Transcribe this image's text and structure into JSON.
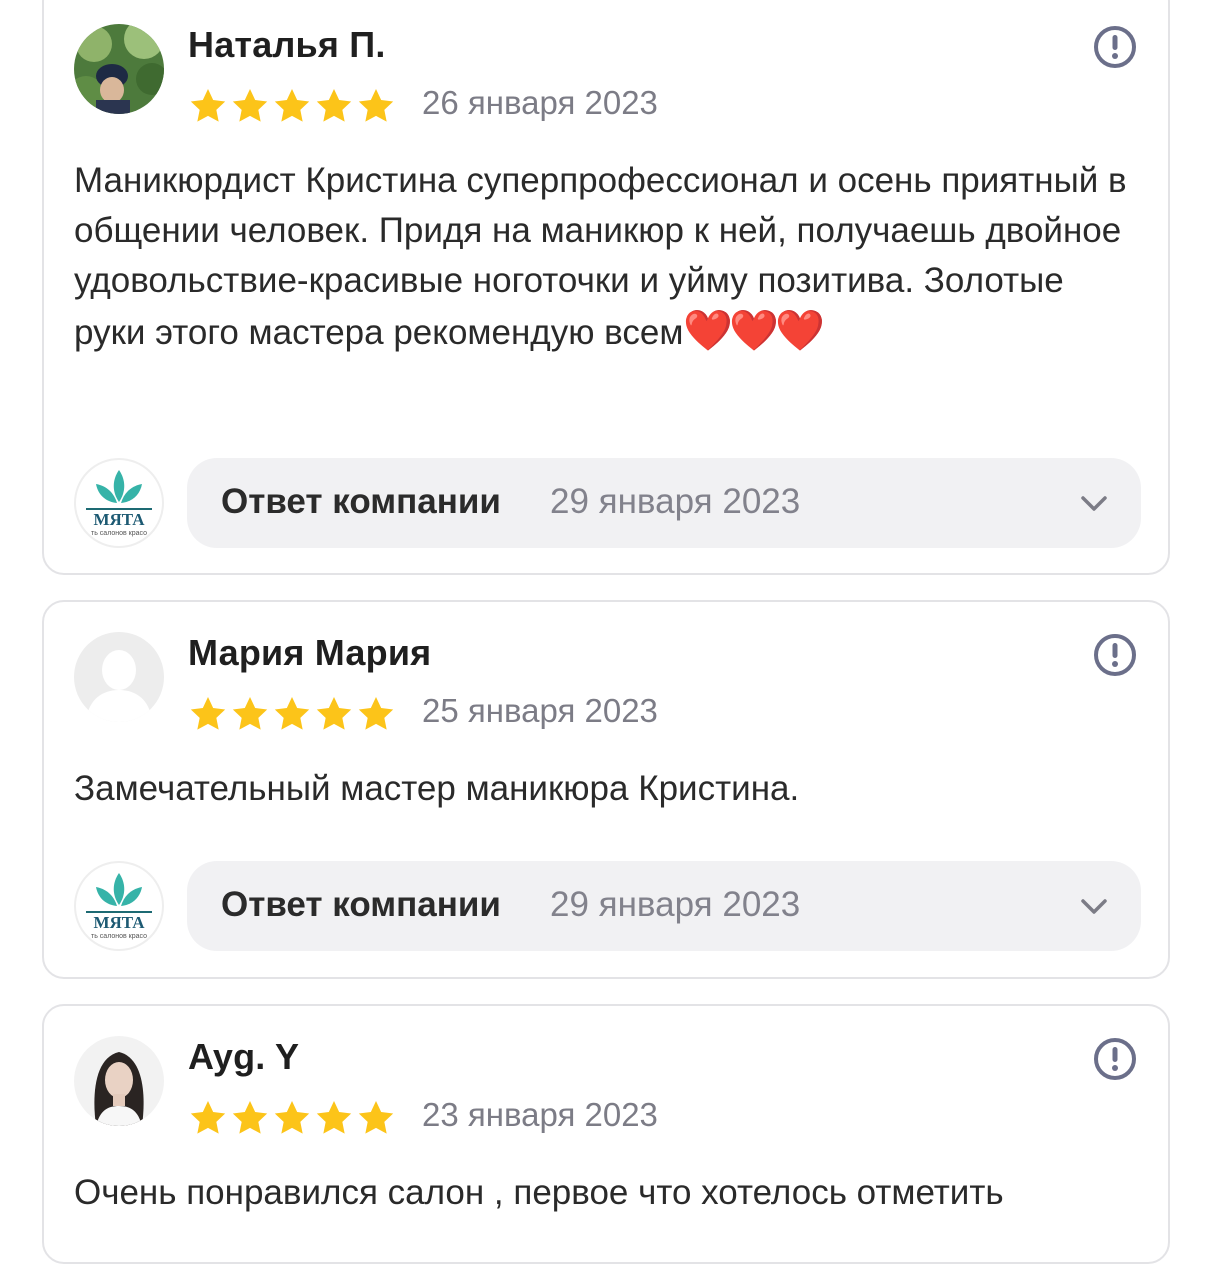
{
  "colors": {
    "star": "#fcc419",
    "report_icon": "#6b6f8a",
    "heart": "#e1222b",
    "logo_leaf": "#36b3a8"
  },
  "company": {
    "logo_text": "МЯТА",
    "logo_subtext": "ть салонов красо"
  },
  "reviews": [
    {
      "author": "Наталья П.",
      "rating": 5,
      "date": "26 января 2023",
      "text": "Маникюрдист Кристина суперпрофессионал и осень приятный в общении человек. Придя на маникюр к ней, получаешь двойное удовольствие-красивые ноготочки и уйму позитива. Золотые руки этого мастера рекомендую всем",
      "emoji": "❤️❤️❤️",
      "reply_label": "Ответ компании",
      "reply_date": "29 января 2023"
    },
    {
      "author": "Мария Мария",
      "rating": 5,
      "date": "25 января 2023",
      "text": "Замечательный мастер маникюра Кристина.",
      "reply_label": "Ответ компании",
      "reply_date": "29 января 2023"
    },
    {
      "author": "Ayg. Y",
      "rating": 5,
      "date": "23 января 2023",
      "text": "Очень понравился салон , первое что хотелось отметить"
    }
  ]
}
